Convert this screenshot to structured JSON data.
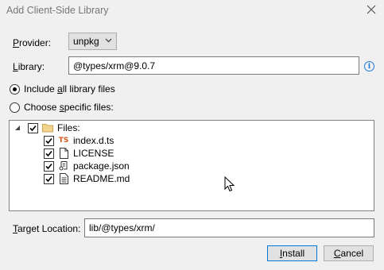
{
  "window": {
    "title": "Add Client-Side Library"
  },
  "provider": {
    "label_pre": "",
    "label_u": "P",
    "label_post": "rovider:",
    "value": "unpkg"
  },
  "library": {
    "label_u": "L",
    "label_post": "ibrary:",
    "value": "@types/xrm@9.0.7"
  },
  "options": {
    "include_all": {
      "pre": "Include ",
      "u": "a",
      "post": "ll library files",
      "selected": true
    },
    "choose_specific": {
      "pre": "Choose ",
      "u": "s",
      "post": "pecific files:",
      "selected": false
    }
  },
  "tree": {
    "root": {
      "label": "Files:",
      "expanded": true,
      "checked": true
    },
    "files": [
      {
        "name": "index.d.ts",
        "icon": "typescript-file-icon",
        "checked": true
      },
      {
        "name": "LICENSE",
        "icon": "file-icon",
        "checked": true
      },
      {
        "name": "package.json",
        "icon": "json-file-icon",
        "checked": true
      },
      {
        "name": "README.md",
        "icon": "markdown-file-icon",
        "checked": true
      }
    ]
  },
  "target": {
    "label_u": "T",
    "label_post": "arget Location:",
    "value": "lib/@types/xrm/"
  },
  "buttons": {
    "install": {
      "u": "I",
      "post": "nstall"
    },
    "cancel": {
      "u": "C",
      "post": "ancel"
    }
  },
  "colors": {
    "accent": "#0078d7",
    "info": "#1e7ad8",
    "ts": "#d7561d"
  }
}
